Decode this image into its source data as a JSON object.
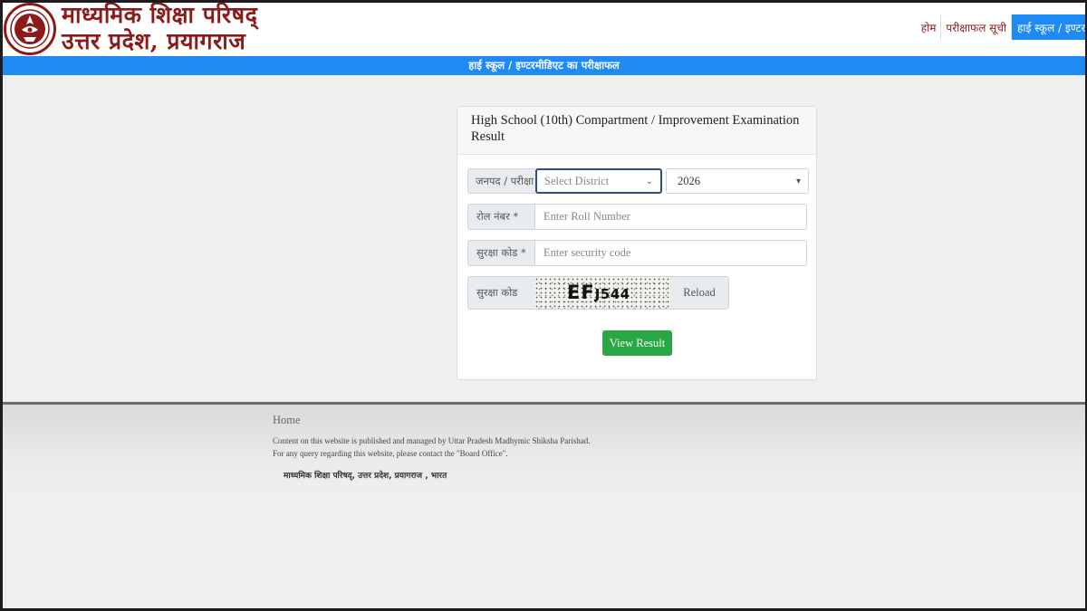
{
  "header": {
    "brand_line1": "माध्यमिक शिक्षा परिषद्",
    "brand_line2": "उत्तर प्रदेश, प्रयागराज",
    "nav": [
      {
        "label": "होम"
      },
      {
        "label": "परीक्षाफल सूची"
      },
      {
        "label": "हाई स्कूल / इण्टरमीडिएट का परीक्षाफल"
      }
    ]
  },
  "banner": {
    "title": "हाई स्कूल / इण्टरमीडिएट का परीक्षाफल"
  },
  "form": {
    "title": "High School (10th) Compartment / Improvement Examination Result",
    "district_label": "जनपद / परीक्षा",
    "district_placeholder": "Select District",
    "year_value": "2026",
    "roll_label": "रोल नंबर *",
    "roll_placeholder": "Enter Roll Number",
    "security_label": "सुरक्षा कोड *",
    "security_placeholder": "Enter security code",
    "captcha_label": "सुरक्षा कोड",
    "captcha_main": "EF",
    "captcha_small": "J544",
    "reload_label": "Reload",
    "submit_label": "View Result"
  },
  "footer": {
    "home_link": "Home",
    "line1": "Content on this website is published and managed by Uttar Pradesh Madhymic Shiksha Parishad.",
    "line2": "For any query regarding this website, please contact the \"Board Office\".",
    "address": "माध्यमिक शिक्षा परिषद्, उत्तर प्रदेश, प्रयागराज , भारत"
  },
  "colors": {
    "brand": "#8b1a1a",
    "accent_blue": "#1e8bf5",
    "submit_green": "#28a745"
  }
}
